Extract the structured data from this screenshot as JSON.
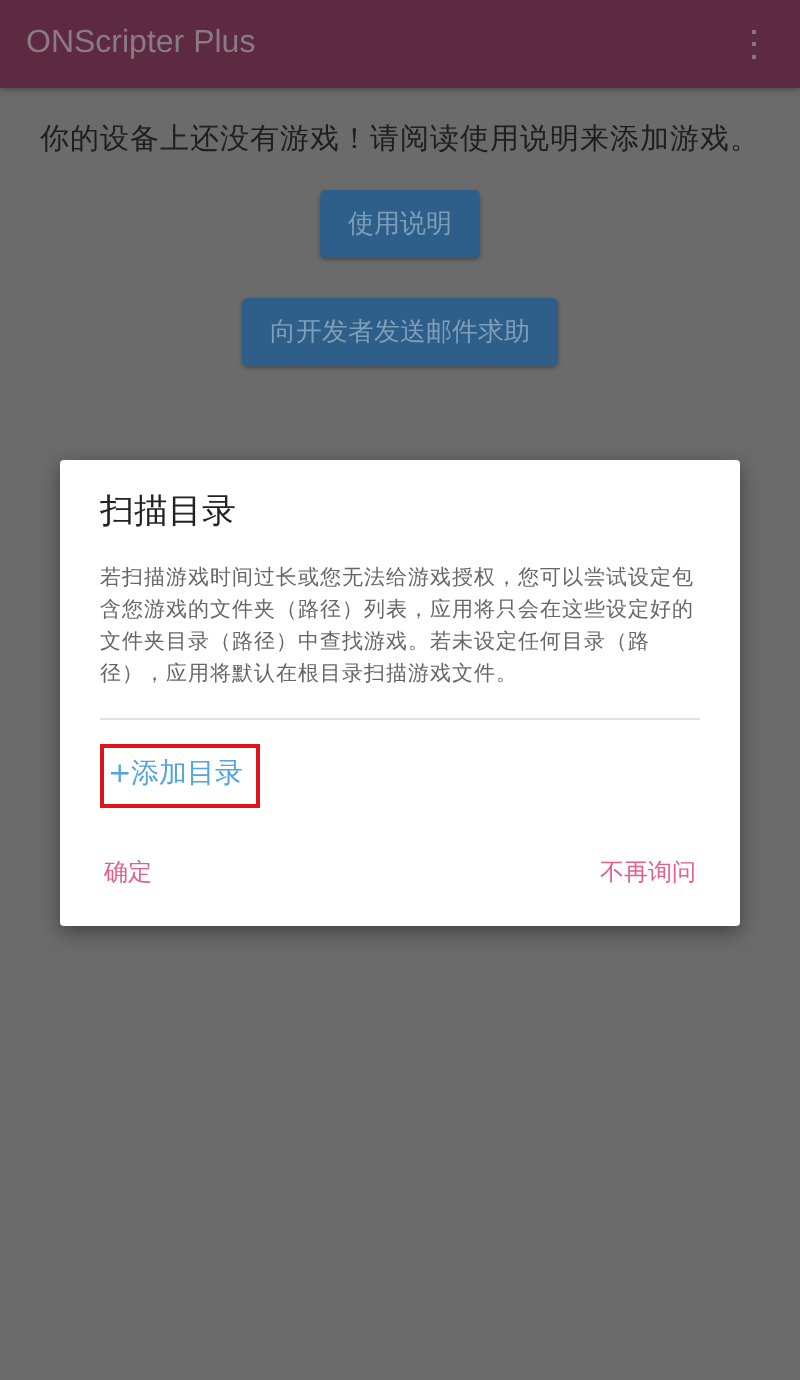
{
  "app_bar": {
    "title": "ONScripter Plus",
    "menu": "⋮"
  },
  "message": "你的设备上还没有游戏！请阅读使用说明来添加游戏。",
  "buttons": [
    "使用说明",
    "向开发者发送邮件求助"
  ],
  "dialog": {
    "title": "扫描目录",
    "body": "若扫描游戏时间过长或您无法给游戏授权，您可以尝试设定包含您游戏的文件夹（路径）列表，应用将只会在这些设定好的文件夹目录（路径）中查找游戏。若未设定任何目录（路径），应用将默认在根目录扫描游戏文件。",
    "add_link": {
      "label": "+添加目录",
      "highlighted": true
    },
    "actions": [
      "确定",
      "不再询问"
    ]
  }
}
